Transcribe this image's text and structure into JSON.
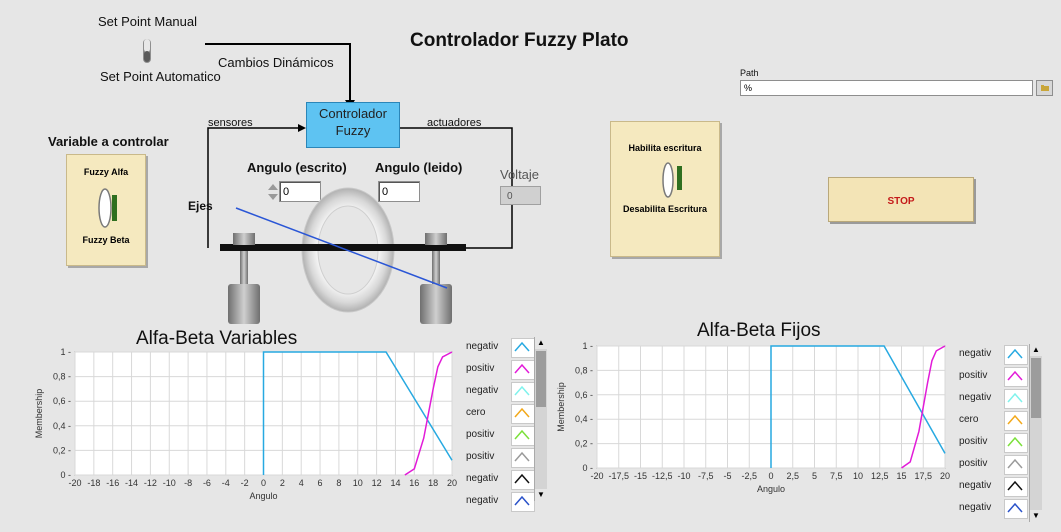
{
  "title": "Controlador Fuzzy Plato",
  "setpoint": {
    "manual_label": "Set Point Manual",
    "auto_label": "Set Point Automatico"
  },
  "cambios_label": "Cambios Dinámicos",
  "controller": {
    "label_line1": "Controlador",
    "label_line2": "Fuzzy",
    "sensores_label": "sensores",
    "actuadores_label": "actuadores"
  },
  "variable_selector": {
    "heading": "Variable a controlar",
    "top_label": "Fuzzy Alfa",
    "bottom_label": "Fuzzy Beta"
  },
  "angles": {
    "escrito_label": "Angulo (escrito)",
    "escrito_value": "0",
    "leido_label": "Angulo (leido)",
    "leido_value": "0"
  },
  "voltaje": {
    "label": "Voltaje",
    "value": "0"
  },
  "ejes_label": "Ejes",
  "path": {
    "label": "Path",
    "value": "%"
  },
  "write_switch": {
    "top_label": "Habilita escritura",
    "bottom_label": "Desabilita Escritura"
  },
  "stop_label": "STOP",
  "charts": [
    {
      "title": "Alfa-Beta Variables",
      "ylabel": "Membership",
      "xlabel": "Angulo",
      "x_ticks": [
        "-20",
        "-18",
        "-16",
        "-14",
        "-12",
        "-10",
        "-8",
        "-6",
        "-4",
        "-2",
        "0",
        "2",
        "4",
        "6",
        "8",
        "10",
        "12",
        "14",
        "16",
        "18",
        "20"
      ],
      "y_ticks": [
        "1",
        "0,8",
        "0,6",
        "0,4",
        "0,2",
        "0"
      ],
      "legend": [
        "negativ",
        "positiv",
        "negativ",
        "cero",
        "positiv",
        "positiv",
        "negativ",
        "negativ"
      ]
    },
    {
      "title": "Alfa-Beta Fijos",
      "ylabel": "Membership",
      "xlabel": "Angulo",
      "x_ticks": [
        "-20",
        "-17,5",
        "-15",
        "-12,5",
        "-10",
        "-7,5",
        "-5",
        "-2,5",
        "0",
        "2,5",
        "5",
        "7,5",
        "10",
        "12,5",
        "15",
        "17,5",
        "20"
      ],
      "y_ticks": [
        "1",
        "0,8",
        "0,6",
        "0,4",
        "0,2",
        "0"
      ],
      "legend": [
        "negativ",
        "positiv",
        "negativ",
        "cero",
        "positiv",
        "positiv",
        "negativ",
        "negativ"
      ]
    }
  ],
  "chart_data": [
    {
      "type": "line",
      "title": "Alfa-Beta Variables",
      "xlabel": "Angulo",
      "ylabel": "Membership",
      "xlim": [
        -20,
        20
      ],
      "ylim": [
        0,
        1
      ],
      "grid": true,
      "legend_position": "right",
      "series": [
        {
          "name": "negativ",
          "color": "#27a9e1",
          "x": [
            0,
            0,
            13,
            20
          ],
          "y": [
            0,
            1,
            1,
            0.12
          ]
        },
        {
          "name": "positiv",
          "color": "#e21bd8",
          "x": [
            15,
            16,
            17,
            17.5,
            18,
            18.5,
            19,
            20
          ],
          "y": [
            0,
            0.05,
            0.3,
            0.5,
            0.7,
            0.88,
            0.96,
            1
          ]
        }
      ]
    },
    {
      "type": "line",
      "title": "Alfa-Beta Fijos",
      "xlabel": "Angulo",
      "ylabel": "Membership",
      "xlim": [
        -20,
        20
      ],
      "ylim": [
        0,
        1
      ],
      "grid": true,
      "legend_position": "right",
      "series": [
        {
          "name": "negativ",
          "color": "#27a9e1",
          "x": [
            0,
            0,
            13,
            20
          ],
          "y": [
            0,
            1,
            1,
            0.12
          ]
        },
        {
          "name": "positiv",
          "color": "#e21bd8",
          "x": [
            15,
            16,
            17,
            17.5,
            18,
            18.5,
            19,
            20
          ],
          "y": [
            0,
            0.05,
            0.3,
            0.5,
            0.7,
            0.88,
            0.96,
            1
          ]
        }
      ]
    }
  ],
  "colors": {
    "legend": [
      "#27a9e1",
      "#e21bd8",
      "#7ff2ec",
      "#f2a81a",
      "#7be03a",
      "#9a9a9a",
      "#111111",
      "#2a52c9"
    ]
  }
}
